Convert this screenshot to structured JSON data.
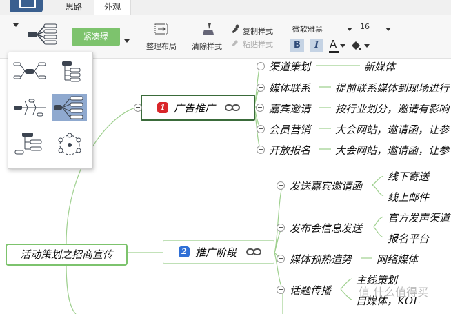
{
  "tabs": [
    "思路",
    "外观"
  ],
  "toolbar": {
    "theme_label": "紧凑绿",
    "tidy_label": "整理布局",
    "clear_style_label": "清除样式",
    "copy_style_label": "复制样式",
    "paste_style_label": "粘贴样式",
    "font_name": "微软雅黑",
    "font_size": "16",
    "bold": "B",
    "italic": "I",
    "font_color": "A"
  },
  "layout_options": [
    "logic-center",
    "org-tree",
    "fishbone",
    "logic-right",
    "tree-down",
    "radial"
  ],
  "mindmap": {
    "root": "活动策划之招商宣传",
    "branch1": {
      "num": "1",
      "label": "广告推广",
      "children": [
        {
          "label": "渠道策划",
          "detail": "新媒体"
        },
        {
          "label": "媒体联系",
          "detail": "提前联系媒体到现场进行"
        },
        {
          "label": "嘉宾邀请",
          "detail": "按行业划分，邀请有影响"
        },
        {
          "label": "会员营销",
          "detail": "大会网站，邀请函，让参"
        },
        {
          "label": "开放报名",
          "detail": "大会网站，邀请函，让参"
        }
      ]
    },
    "branch2": {
      "num": "2",
      "label": "推广阶段",
      "children": [
        {
          "label": "发送嘉宾邀请函",
          "details": [
            "线下寄送",
            "线上邮件"
          ]
        },
        {
          "label": "发布会信息发送",
          "details": [
            "官方发声渠道",
            "报名平台"
          ]
        },
        {
          "label": "媒体预热造势",
          "details": [
            "网络媒体"
          ]
        },
        {
          "label": "话题传播",
          "details": [
            "主线策划",
            "自媒体，KOL"
          ]
        }
      ]
    }
  },
  "watermark": "值 什么值得买"
}
